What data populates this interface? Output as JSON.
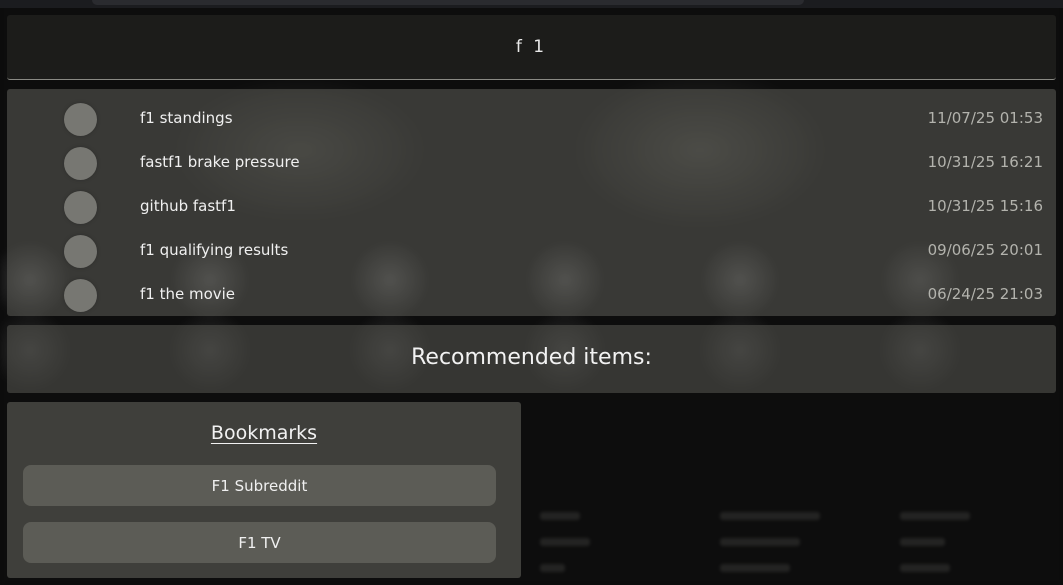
{
  "search": {
    "value": "f 1"
  },
  "history": {
    "items": [
      {
        "label": "f1 standings",
        "time": "11/07/25 01:53"
      },
      {
        "label": "fastf1 brake pressure",
        "time": "10/31/25 16:21"
      },
      {
        "label": "github fastf1",
        "time": "10/31/25 15:16"
      },
      {
        "label": "f1 qualifying results",
        "time": "09/06/25 20:01"
      },
      {
        "label": "f1 the movie",
        "time": "06/24/25 21:03"
      }
    ]
  },
  "recommended": {
    "title": "Recommended items:"
  },
  "bookmarks": {
    "title": "Bookmarks",
    "items": [
      {
        "label": "F1 Subreddit"
      },
      {
        "label": "F1 TV"
      }
    ]
  },
  "colors": {
    "background": "#0d0d0d",
    "search_panel": "#1c1c1a",
    "favicon": "#777772",
    "bookmark_button": "#5c5c56"
  }
}
